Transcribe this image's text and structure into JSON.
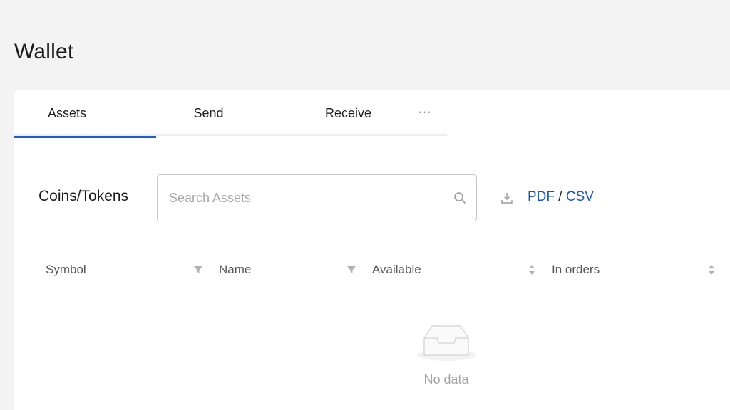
{
  "page": {
    "title": "Wallet"
  },
  "tabs": [
    {
      "label": "Assets",
      "active": true
    },
    {
      "label": "Send",
      "active": false
    },
    {
      "label": "Receive",
      "active": false
    }
  ],
  "tabs_more_label": "···",
  "assets": {
    "section_label": "Coins/Tokens",
    "search": {
      "placeholder": "Search Assets",
      "value": ""
    },
    "export": {
      "pdf_label": "PDF",
      "separator": " / ",
      "csv_label": "CSV"
    },
    "table": {
      "columns": [
        {
          "label": "Symbol",
          "control": "filter"
        },
        {
          "label": "Name",
          "control": "filter"
        },
        {
          "label": "Available",
          "control": "sort"
        },
        {
          "label": "In orders",
          "control": "sort"
        }
      ],
      "rows": []
    },
    "empty_text": "No data"
  },
  "colors": {
    "accent": "#1e5fd0",
    "link": "#1a53c4",
    "background": "#f3f3f3",
    "card": "#ffffff"
  },
  "icons": {
    "search": "search-icon",
    "download": "download-icon",
    "filter": "filter-icon",
    "sort": "sort-icon",
    "empty": "empty-inbox-icon"
  }
}
